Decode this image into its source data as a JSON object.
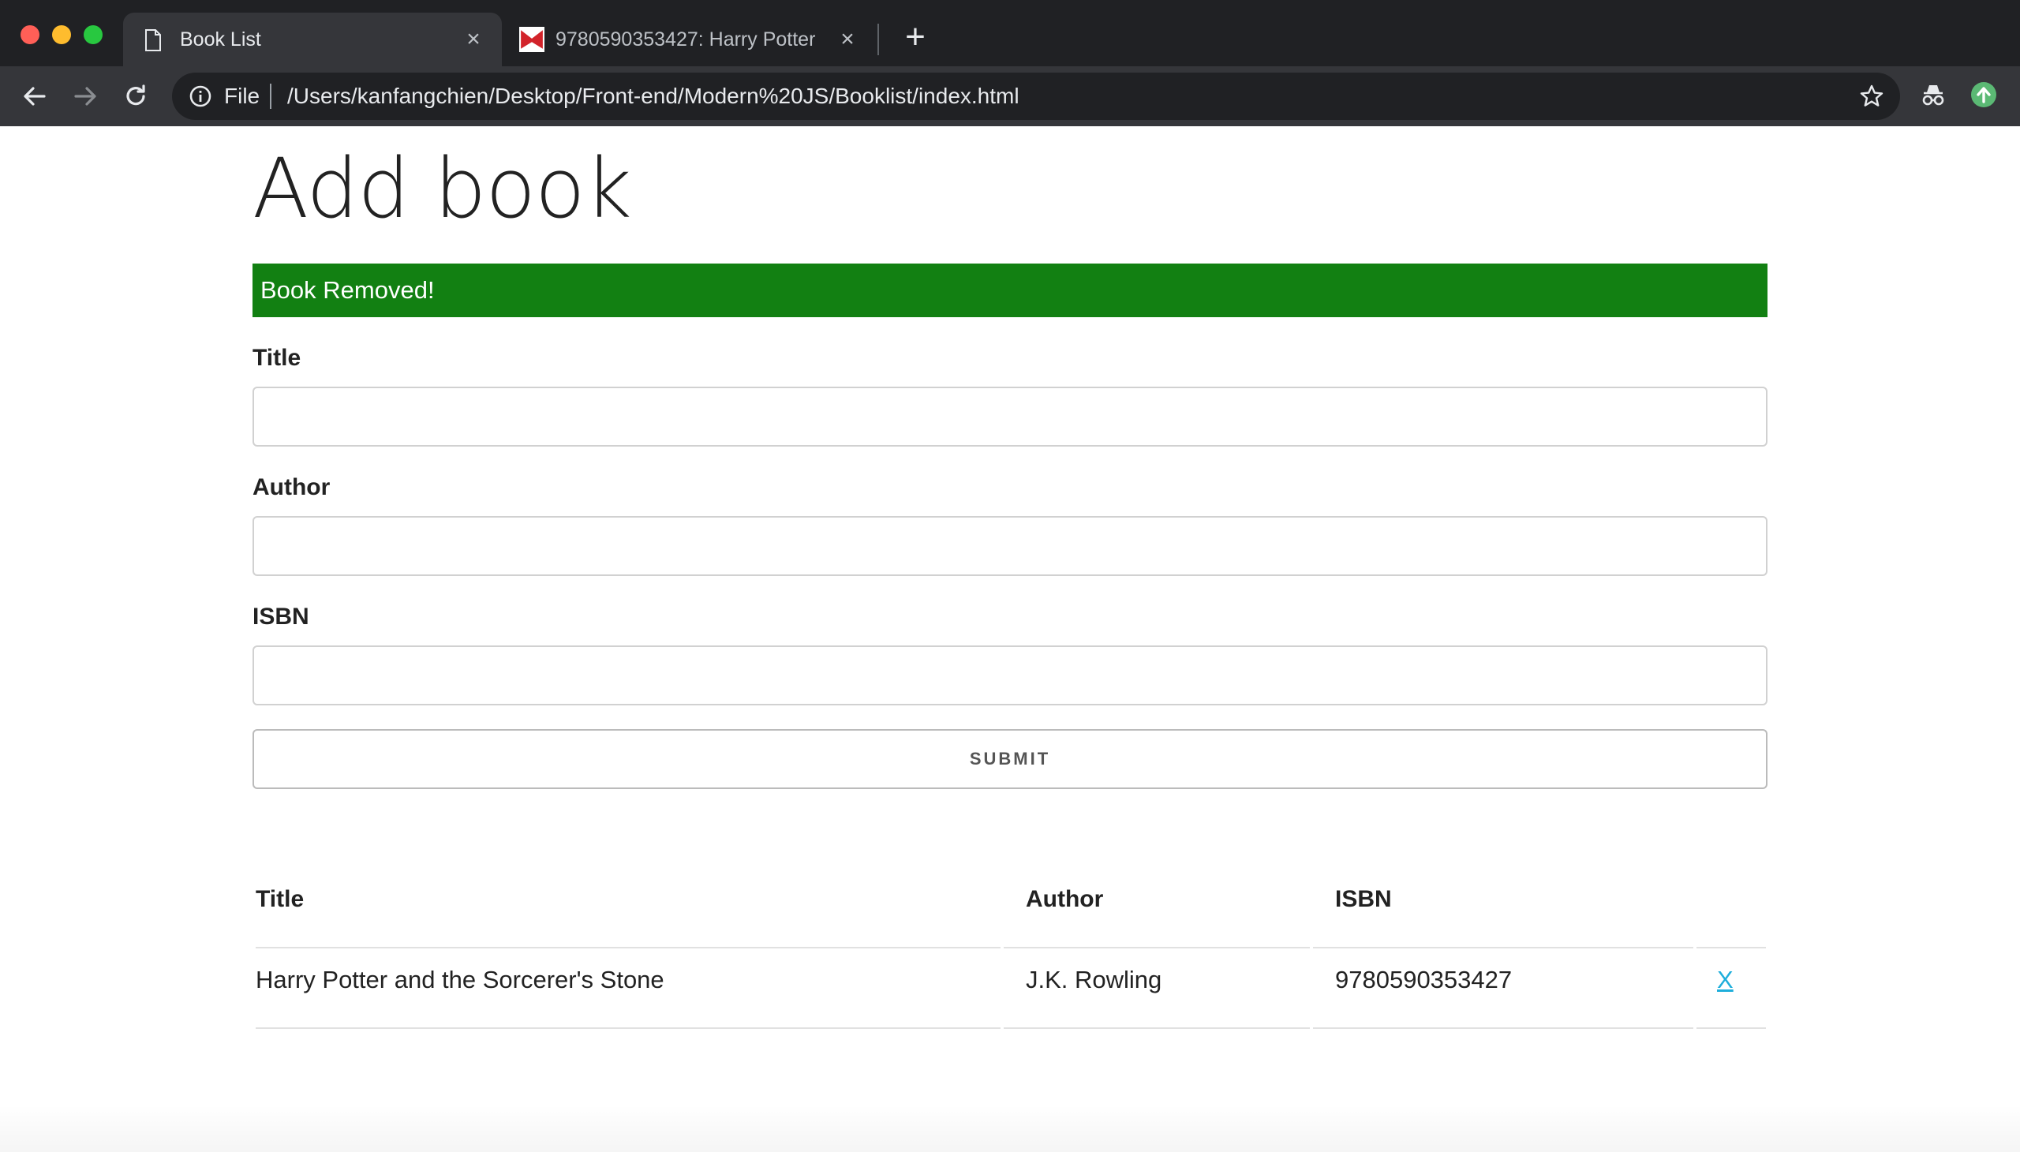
{
  "browser": {
    "tabs": [
      {
        "title": "Book List",
        "icon": "document-icon",
        "active": true
      },
      {
        "title": "9780590353427: Harry Potter",
        "icon": "bookseller-logo-icon",
        "active": false
      }
    ],
    "address": {
      "scheme": "File",
      "url": "/Users/kanfangchien/Desktop/Front-end/Modern%20JS/Booklist/index.html"
    }
  },
  "page": {
    "title": "Add book",
    "alert": {
      "text": "Book Removed!",
      "color": "#128012"
    },
    "form": {
      "title_label": "Title",
      "author_label": "Author",
      "isbn_label": "ISBN",
      "title_value": "",
      "author_value": "",
      "isbn_value": "",
      "submit_label": "SUBMIT"
    },
    "table": {
      "headers": {
        "title": "Title",
        "author": "Author",
        "isbn": "ISBN"
      },
      "rows": [
        {
          "title": "Harry Potter and the Sorcerer's Stone",
          "author": "J.K. Rowling",
          "isbn": "9780590353427",
          "delete": "X"
        }
      ]
    }
  }
}
